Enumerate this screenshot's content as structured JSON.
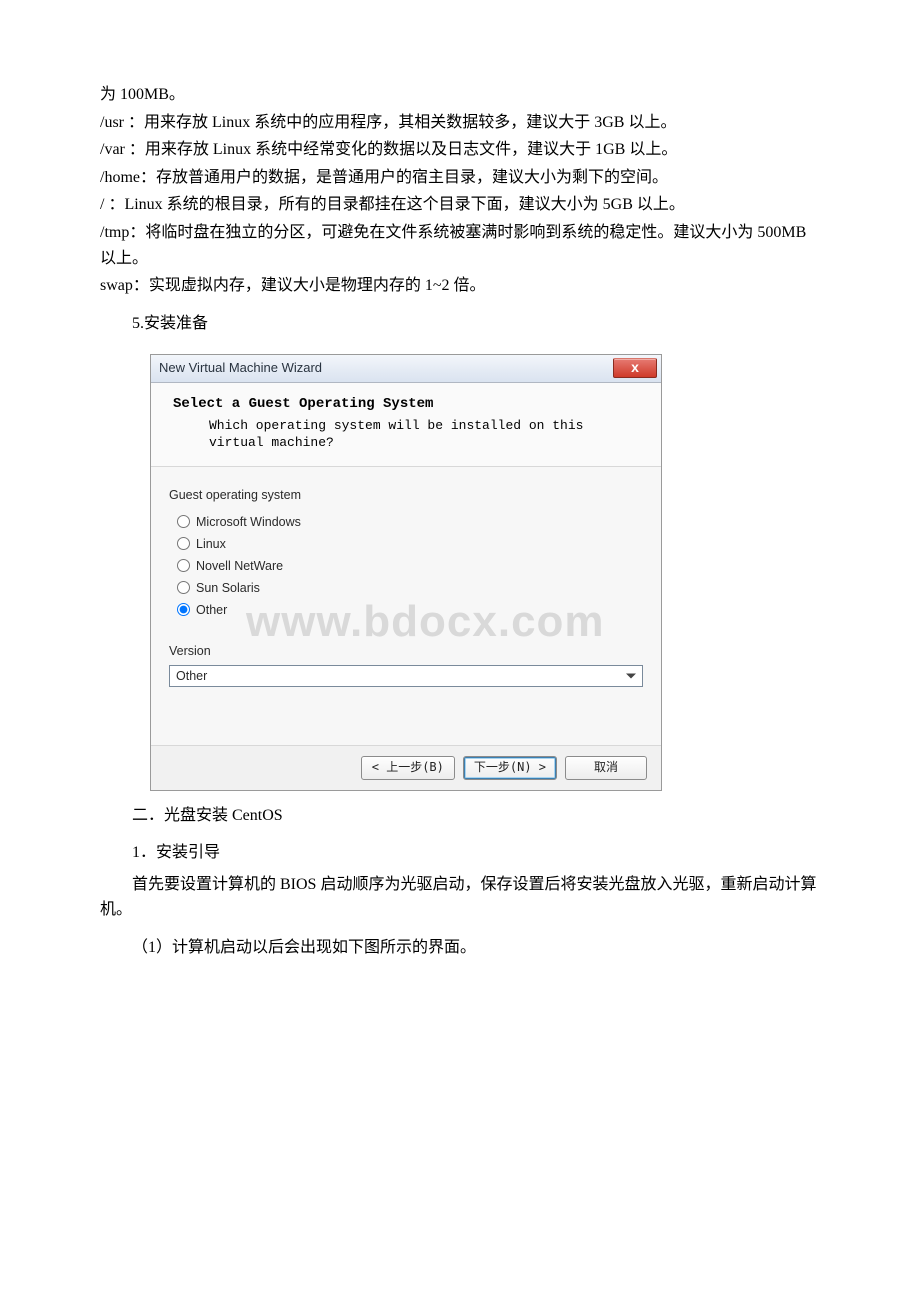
{
  "intro": {
    "l0": "为 100MB。",
    "l1": "/usr ：用来存放 Linux 系统中的应用程序，其相关数据较多，建议大于 3GB 以上。",
    "l2": "/var ：用来存放 Linux 系统中经常变化的数据以及日志文件，建议大于 1GB 以上。",
    "l3": "/home：存放普通用户的数据，是普通用户的宿主目录，建议大小为剩下的空间。",
    "l4": "/ ：Linux 系统的根目录，所有的目录都挂在这个目录下面，建议大小为 5GB 以上。",
    "l5": "/tmp：将临时盘在独立的分区，可避免在文件系统被塞满时影响到系统的稳定性。建议大小为 500MB 以上。",
    "l6": "swap：实现虚拟内存，建议大小是物理内存的 1~2 倍。"
  },
  "sections": {
    "prepare": "5.安装准备",
    "cdinstall": "二．光盘安装 CentOS",
    "boot": "1．安装引导",
    "bootdesc": "首先要设置计算机的 BIOS 启动顺序为光驱启动，保存设置后将安装光盘放入光驱，重新启动计算机。",
    "step1": "（1）计算机启动以后会出现如下图所示的界面。"
  },
  "dialog": {
    "title": "New Virtual Machine Wizard",
    "close": "x",
    "heading": "Select a Guest Operating System",
    "subheading": "Which operating system will be installed on this virtual machine?",
    "grouplabel": "Guest operating system",
    "options": {
      "win": "Microsoft Windows",
      "linux": "Linux",
      "netware": "Novell NetWare",
      "solaris": "Sun Solaris",
      "other": "Other"
    },
    "selected": "other",
    "versionlabel": "Version",
    "versionvalue": "Other",
    "buttons": {
      "back": "< 上一步(B)",
      "next": "下一步(N) >",
      "cancel": "取消"
    },
    "watermark": "www.bdocx.com"
  }
}
